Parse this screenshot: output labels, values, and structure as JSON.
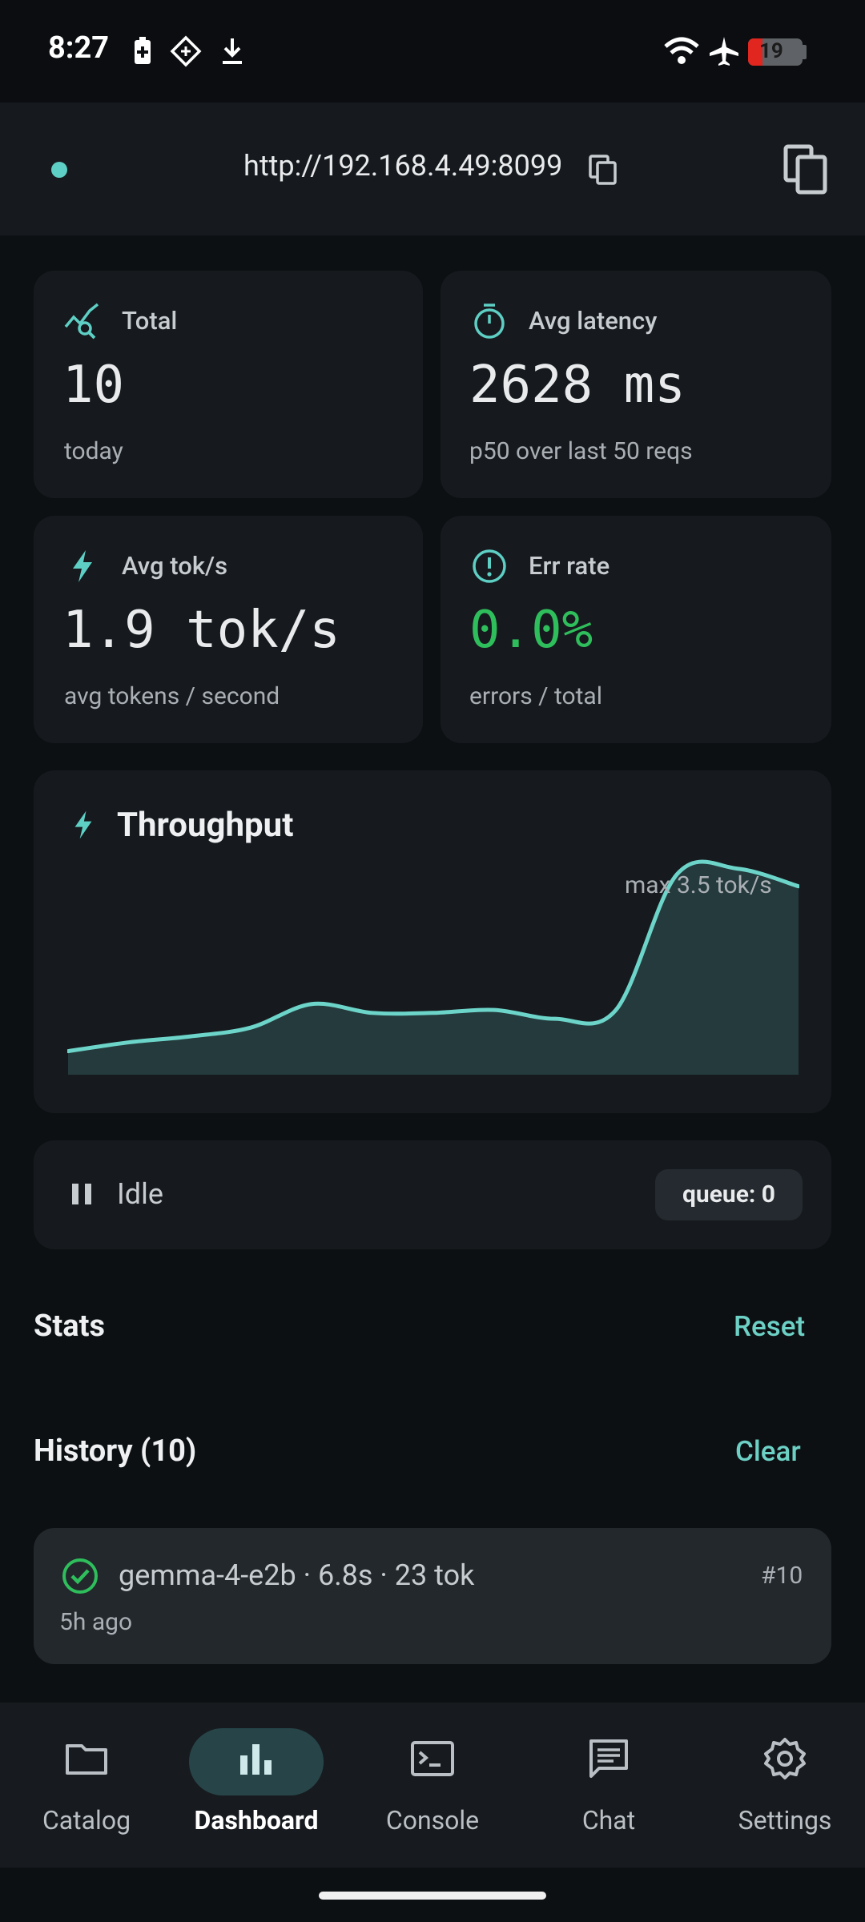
{
  "status_bar": {
    "time": "8:27",
    "battery": "19"
  },
  "url_bar": {
    "url": "http://192.168.4.49:8099"
  },
  "stats_cards": {
    "total": {
      "label": "Total",
      "value": "10",
      "sub": "today"
    },
    "latency": {
      "label": "Avg latency",
      "value": "2628 ms",
      "sub": "p50 over last 50 reqs"
    },
    "toks": {
      "label": "Avg tok/s",
      "value": "1.9 tok/s",
      "sub": "avg tokens / second"
    },
    "err": {
      "label": "Err rate",
      "value": "0.0%",
      "sub": "errors / total"
    }
  },
  "throughput": {
    "title": "Throughput",
    "max_label": "max 3.5 tok/s"
  },
  "chart_data": {
    "type": "area",
    "title": "Throughput",
    "series": [
      {
        "values": [
          0.4,
          0.55,
          0.65,
          0.8,
          1.2,
          1.05,
          1.05,
          1.1,
          0.95,
          1.1,
          3.4,
          3.5,
          3.2
        ]
      }
    ],
    "ylim": [
      0,
      3.7
    ]
  },
  "idle": {
    "label": "Idle",
    "queue": "queue: 0"
  },
  "stats_section": {
    "title": "Stats",
    "reset": "Reset"
  },
  "history_section": {
    "title": "History (10)",
    "clear": "Clear",
    "items": [
      {
        "title": "gemma-4-e2b · 6.8s · 23 tok",
        "num": "#10",
        "time": "5h ago"
      }
    ]
  },
  "nav": {
    "items": [
      {
        "label": "Catalog"
      },
      {
        "label": "Dashboard"
      },
      {
        "label": "Console"
      },
      {
        "label": "Chat"
      },
      {
        "label": "Settings"
      }
    ]
  },
  "colors": {
    "accent": "#5ecfc4",
    "success": "#2fbe5c",
    "background": "#0d1013",
    "card": "#161a1e"
  }
}
